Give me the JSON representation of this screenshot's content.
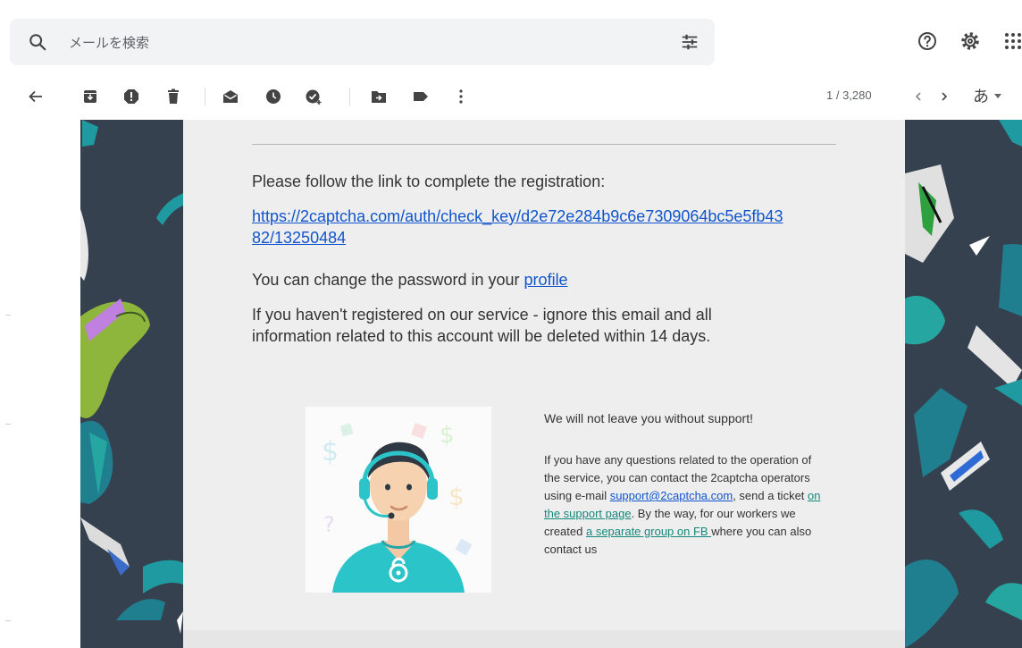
{
  "search": {
    "placeholder": "メールを検索"
  },
  "top_icons": [
    "help-icon",
    "settings-icon",
    "apps-icon"
  ],
  "toolbar": {
    "icons": [
      "back-arrow-icon",
      "archive-icon",
      "report-spam-icon",
      "delete-icon",
      "mark-unread-icon",
      "snooze-icon",
      "add-to-tasks-icon",
      "move-to-icon",
      "label-icon",
      "more-icon"
    ],
    "pager": "1 / 3,280",
    "language": "あ"
  },
  "email": {
    "follow_text": "Please follow the link to complete the registration:",
    "link_line1": "https://2captcha.com/auth/check_key/d2e72e284b9c6e7309064bc5e5fb43",
    "link_line2": "82/13250484",
    "password_text": "You can change the password in your ",
    "profile_link": "profile",
    "ignore_line1": "If you haven't registered on our service - ignore this email and all",
    "ignore_line2": "information related to this account will be deleted within 14 days.",
    "support": {
      "title": "We will not leave you without support!",
      "text1": "If you have any questions related to the operation of the service, you can contact the 2captcha operators using e-mail ",
      "email_link": "support@2captcha.com",
      "text2": ", send a ticket ",
      "page_link": "on the support page",
      "text3": ". By the way, for our workers we created ",
      "fb_link": "a separate group on FB ",
      "text4": "where you can also contact us"
    }
  },
  "colors": {
    "accent_link": "#1155cc",
    "support_link": "#13897c",
    "decor_bg": "#36414f",
    "card_bg": "#eeeeee"
  }
}
